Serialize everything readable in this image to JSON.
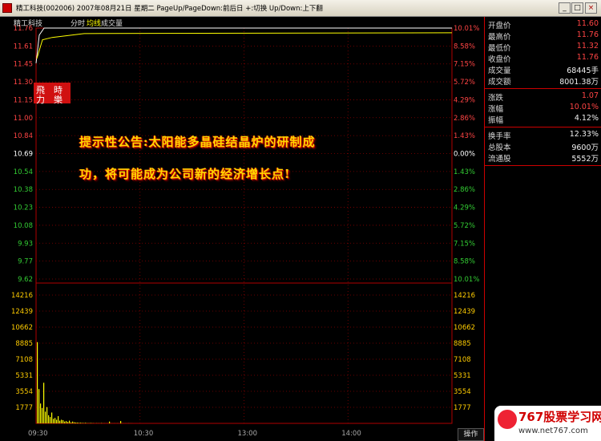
{
  "window": {
    "title": "精工科技(002006)  2007年08月21日 星期二 PageUp/PageDown:前后日 +:切换 Up/Down:上下翻",
    "buttons": [
      "_",
      "□",
      "×"
    ]
  },
  "chart_header": {
    "name": "精工科技",
    "mode": "分时",
    "legend_avg": "均线",
    "legend_vol": "成交量"
  },
  "chart_data": {
    "type": "line",
    "price_axis_left": [
      "11.76",
      "11.61",
      "11.45",
      "11.30",
      "11.15",
      "11.00",
      "10.84",
      "10.69",
      "10.54",
      "10.38",
      "10.23",
      "10.08",
      "9.93",
      "9.77",
      "9.62"
    ],
    "pct_axis_right": [
      "10.01%",
      "8.58%",
      "7.15%",
      "5.72%",
      "4.29%",
      "2.86%",
      "1.43%",
      "0.00%",
      "1.43%",
      "2.86%",
      "4.29%",
      "5.72%",
      "7.15%",
      "8.58%",
      "10.01%"
    ],
    "pct_colors": [
      "#ff4444",
      "#ff4444",
      "#ff4444",
      "#ff4444",
      "#ff4444",
      "#ff4444",
      "#ff4444",
      "#ffffff",
      "#33cc33",
      "#33cc33",
      "#33cc33",
      "#33cc33",
      "#33cc33",
      "#33cc33",
      "#33cc33"
    ],
    "price_colors": [
      "#ff4444",
      "#ff4444",
      "#ff4444",
      "#ff4444",
      "#ff4444",
      "#ff4444",
      "#ff4444",
      "#ffffff",
      "#33cc33",
      "#33cc33",
      "#33cc33",
      "#33cc33",
      "#33cc33",
      "#33cc33",
      "#33cc33"
    ],
    "volume_axis": [
      "14216",
      "12439",
      "10662",
      "8885",
      "7108",
      "5331",
      "3554",
      "1777"
    ],
    "time_axis": [
      "09:30",
      "10:30",
      "13:00",
      "14:00"
    ],
    "price_line": {
      "open": 11.46,
      "min": 11.46,
      "max": 11.76,
      "close": 11.76
    },
    "avg_line_level": 11.72,
    "ylim": [
      9.62,
      11.76
    ],
    "volume_ylim": [
      0,
      14216
    ],
    "volume_bars": [
      9000,
      3800,
      2200,
      1700,
      4500,
      1300,
      1800,
      900,
      700,
      1200,
      500,
      600,
      400,
      800,
      300,
      400,
      350,
      200,
      250,
      150,
      300,
      100,
      200,
      120,
      90,
      80,
      60,
      70,
      50,
      40,
      60,
      30,
      20,
      40,
      30,
      20,
      10,
      20,
      15,
      10,
      30,
      10,
      10,
      5,
      10,
      200,
      10,
      5,
      10,
      5,
      10,
      5,
      260,
      10,
      5,
      5,
      5,
      10,
      5,
      5
    ]
  },
  "popup": {
    "line1": "提示性公告:太阳能多晶硅结晶炉的研制成",
    "line2": "功，将可能成为公司新的经济增长点!"
  },
  "stamp": {
    "chars": [
      "飛",
      "時",
      "力",
      "樂"
    ]
  },
  "info_panel": {
    "rows": [
      {
        "label": "开盘价",
        "value": "11.60",
        "color": "#ff4444"
      },
      {
        "label": "最高价",
        "value": "11.76",
        "color": "#ff4444"
      },
      {
        "label": "最低价",
        "value": "11.32",
        "color": "#ff4444"
      },
      {
        "label": "收盘价",
        "value": "11.76",
        "color": "#ff4444"
      },
      {
        "label": "成交量",
        "value": "68445手",
        "color": "#f0f0f0"
      },
      {
        "label": "成交额",
        "value": "8001.38万",
        "color": "#f0f0f0"
      },
      {
        "label": "涨跌",
        "value": "1.07",
        "color": "#ff4444"
      },
      {
        "label": "涨幅",
        "value": "10.01%",
        "color": "#ff4444"
      },
      {
        "label": "振幅",
        "value": "4.12%",
        "color": "#f0f0f0"
      },
      {
        "label": "换手率",
        "value": "12.33%",
        "color": "#f0f0f0"
      },
      {
        "label": "总股本",
        "value": "9600万",
        "color": "#f0f0f0"
      },
      {
        "label": "流通股",
        "value": "5552万",
        "color": "#f0f0f0"
      }
    ]
  },
  "ops_button": "操作",
  "watermark": {
    "main": "767股票学习网",
    "sub": "www.net767.com"
  }
}
